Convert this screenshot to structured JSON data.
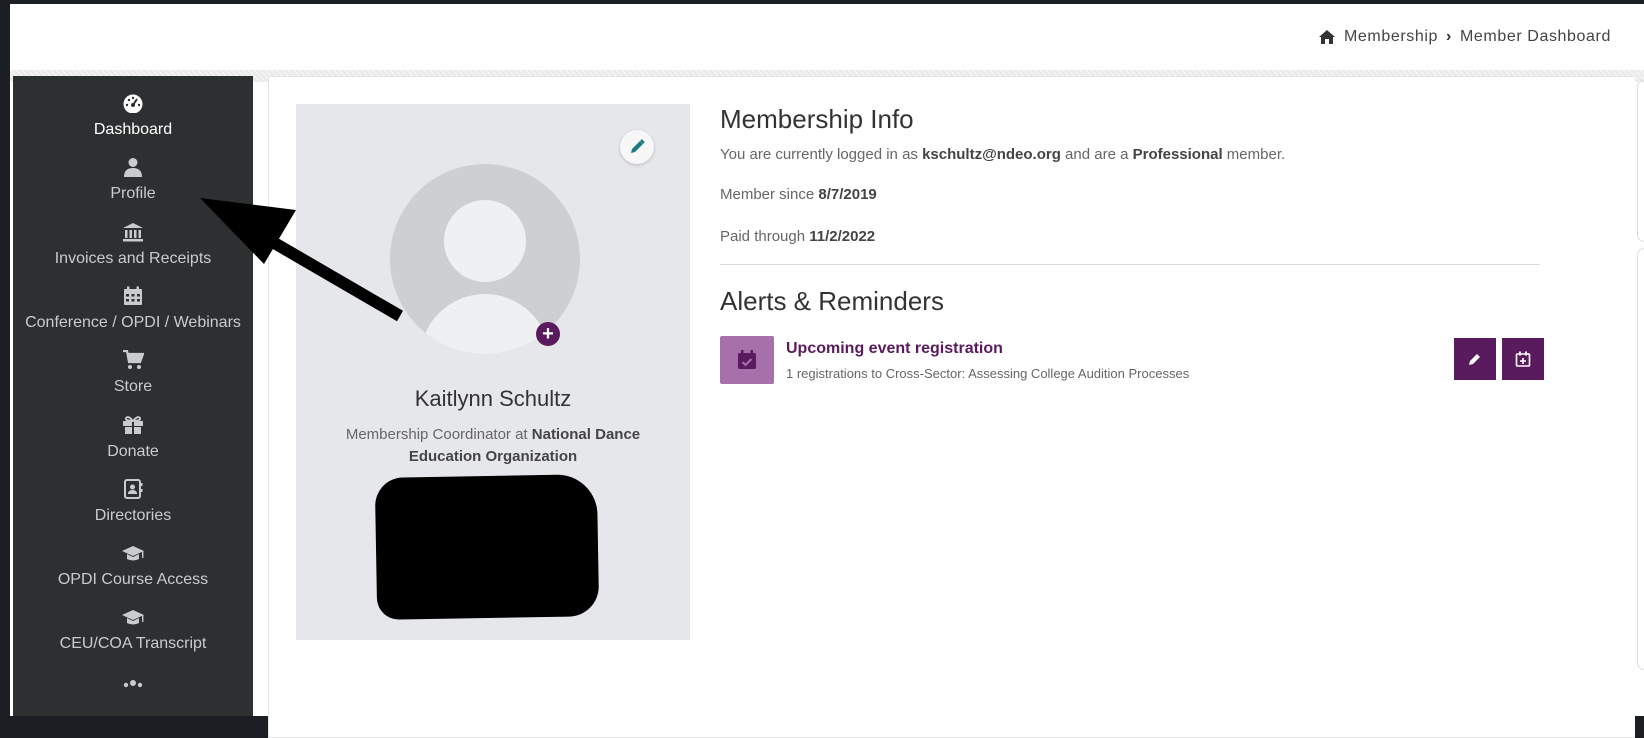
{
  "breadcrumb": {
    "home_icon": "home-icon",
    "items": [
      "Membership",
      "Member Dashboard"
    ]
  },
  "sidebar": {
    "items": [
      {
        "label": "Dashboard",
        "icon": "dashboard-gauge-icon",
        "active": true
      },
      {
        "label": "Profile",
        "icon": "user-icon"
      },
      {
        "label": "Invoices and Receipts",
        "icon": "bank-icon"
      },
      {
        "label": "Conference / OPDI / Webinars",
        "icon": "calendar-icon"
      },
      {
        "label": "Store",
        "icon": "shopping-cart-icon"
      },
      {
        "label": "Donate",
        "icon": "gift-icon"
      },
      {
        "label": "Directories",
        "icon": "address-book-icon"
      },
      {
        "label": "OPDI Course Access",
        "icon": "graduation-cap-icon"
      },
      {
        "label": "CEU/COA Transcript",
        "icon": "graduation-cap-icon"
      }
    ]
  },
  "profile": {
    "name": "Kaitlynn Schultz",
    "title_prefix": "Membership Coordinator at ",
    "organization": "National Dance Education Organization"
  },
  "membership_info": {
    "heading": "Membership Info",
    "login_prefix": "You are currently logged in as ",
    "email": "kschultz@ndeo.org",
    "login_mid": " and are a ",
    "member_type": "Professional",
    "login_suffix": " member.",
    "since_label": "Member since ",
    "since_date": "8/7/2019",
    "paid_label": "Paid through ",
    "paid_date": "11/2/2022"
  },
  "alerts": {
    "heading": "Alerts & Reminders",
    "items": [
      {
        "title": "Upcoming event registration",
        "description": "1 registrations to Cross-Sector: Assessing College Audition Processes",
        "icon": "calendar-check-icon"
      }
    ]
  },
  "colors": {
    "brand_purple": "#5a1a5e",
    "alert_icon_bg": "#a670aa",
    "sidebar_bg": "#2d3031",
    "edit_pencil": "#1a7a80"
  }
}
